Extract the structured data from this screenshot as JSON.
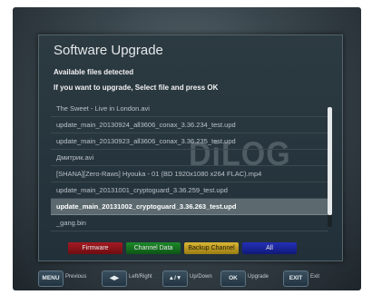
{
  "dialog": {
    "title": "Software Upgrade",
    "note_line1": "Available files detected",
    "note_line2": "If you want to upgrade, Select file and press OK",
    "watermark": "DiLOG"
  },
  "files": [
    {
      "name": "The Sweet - Live in London.avi",
      "selected": false
    },
    {
      "name": "update_main_20130924_all3606_conax_3.36.234_test.upd",
      "selected": false
    },
    {
      "name": "update_main_20130923_all3606_conax_3.36.235_test.upd",
      "selected": false
    },
    {
      "name": "Дмитрик.avi",
      "selected": false
    },
    {
      "name": "[SHANA][Zero-Raws] Hyouka - 01 (BD 1920x1080 x264 FLAC).mp4",
      "selected": false
    },
    {
      "name": "update_main_20131001_cryptoguard_3.36.259_test.upd",
      "selected": false
    },
    {
      "name": "update_main_20131002_cryptoguard_3.36.263_test.upd",
      "selected": true
    },
    {
      "name": "_gang.bin",
      "selected": false
    }
  ],
  "scroll": {
    "position_fraction": 0.0,
    "visible_fraction": 0.9
  },
  "color_buttons": {
    "red": "Firmware",
    "green": "Channel Data",
    "yellow": "Backup Channel",
    "blue": "All"
  },
  "hints": [
    {
      "key": "MENU",
      "label": "Previous"
    },
    {
      "key": "◀▶",
      "label": "Left/Right"
    },
    {
      "key": "▲/▼",
      "label": "Up/Down"
    },
    {
      "key": "OK",
      "label": "Upgrade"
    },
    {
      "key": "EXIT",
      "label": "Exit"
    }
  ],
  "colors": {
    "selected_row": "#5c6a70",
    "red": "#a51b22",
    "green": "#1d8a2a",
    "yellow": "#d9b634",
    "blue": "#2430b8"
  }
}
